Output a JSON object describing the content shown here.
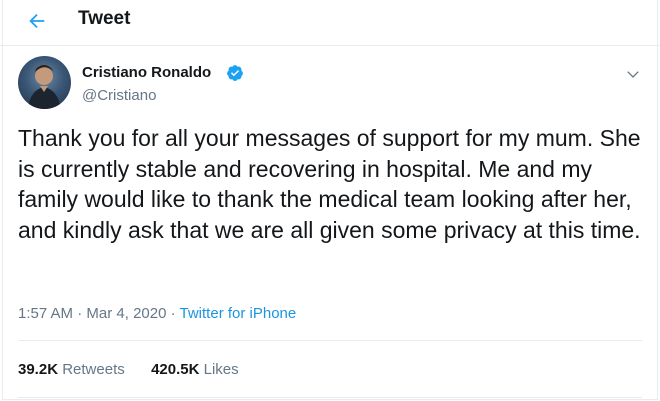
{
  "header": {
    "title": "Tweet",
    "back_icon": "arrow-left-icon"
  },
  "tweet": {
    "author_name": "Cristiano Ronaldo",
    "author_handle": "@Cristiano",
    "verified_icon": "verified-badge-icon",
    "text": "Thank you for all your messages of support for my mum. She is currently stable and recovering in hospital. Me and my family would like to thank the medical team looking after her, and kindly ask that we are all given some privacy at this time.",
    "time": "1:57 AM",
    "date": "Mar 4, 2020",
    "source": "Twitter for iPhone",
    "retweets_count": "39.2K",
    "retweets_label": "Retweets",
    "likes_count": "420.5K",
    "likes_label": "Likes"
  },
  "colors": {
    "accent": "#1da1f2",
    "link": "#1b95e0",
    "secondary_text": "#657786",
    "primary_text": "#14171a",
    "border": "#e6ecf0"
  }
}
